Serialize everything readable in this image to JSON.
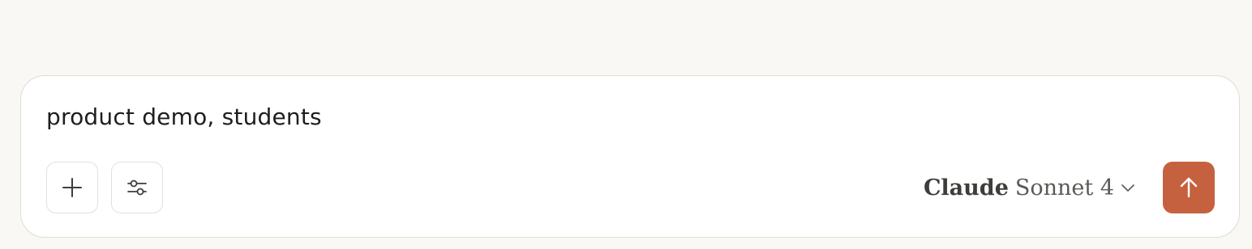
{
  "composer": {
    "input_value": "product demo, students",
    "add_icon": "plus-icon",
    "tools_icon": "sliders-icon",
    "model": {
      "brand": "Claude",
      "name": "Sonnet 4",
      "icon": "chevron-down-icon"
    },
    "send_icon": "arrow-up-icon"
  },
  "colors": {
    "page_background": "#f9f8f5",
    "send_button": "#c6613f",
    "text": "#1f1e1d"
  }
}
